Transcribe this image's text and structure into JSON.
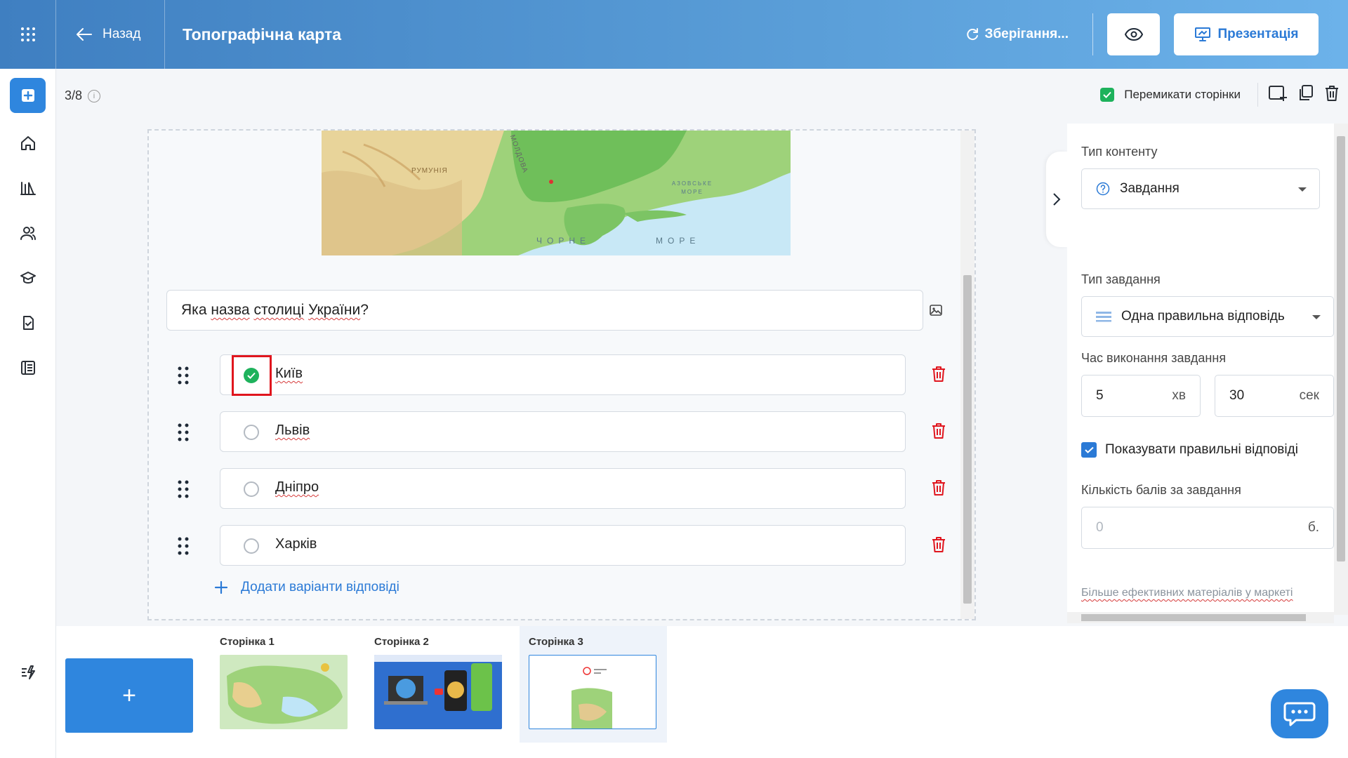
{
  "header": {
    "back_label": "Назад",
    "title": "Топографічна карта",
    "saving_label": "Зберігання...",
    "present_label": "Презентація"
  },
  "toolbar": {
    "page_counter": "3/8",
    "switch_pages_label": "Перемикати сторінки"
  },
  "map": {
    "labels": [
      "РУМУНІЯ",
      "МОЛДОВА",
      "ЧОРНЕ",
      "МОРЕ",
      "АЗОВСЬКЕ МОРЕ"
    ]
  },
  "question": {
    "text_parts": [
      "Яка ",
      "назва",
      " ",
      "столиці",
      " ",
      "України",
      "?"
    ]
  },
  "answers": [
    {
      "text": "Київ",
      "correct": true
    },
    {
      "text": "Львів",
      "correct": false
    },
    {
      "text": "Дніпро",
      "correct": false
    },
    {
      "text": "Харків",
      "correct": false
    }
  ],
  "add_answers_label": "Додати варіанти відповіді",
  "settings": {
    "content_type_label": "Тип контенту",
    "content_type_value": "Завдання",
    "task_type_label": "Тип завдання",
    "task_type_value": "Одна правильна відповідь",
    "time_label": "Час виконання завдання",
    "minutes_value": "5",
    "minutes_unit": "хв",
    "seconds_value": "30",
    "seconds_unit": "сек",
    "show_correct_label": "Показувати правильні відповіді",
    "points_label": "Кількість балів за завдання",
    "points_placeholder": "0",
    "points_unit": "б.",
    "more_materials": "Більше ефективних матеріалів у маркеті"
  },
  "pages": [
    {
      "label": "Сторінка 1"
    },
    {
      "label": "Сторінка 2"
    },
    {
      "label": "Сторінка 3"
    }
  ],
  "add_page_label": "+",
  "colors": {
    "accent": "#2f86de",
    "correct": "#1eb25c",
    "delete": "#e0161e"
  }
}
